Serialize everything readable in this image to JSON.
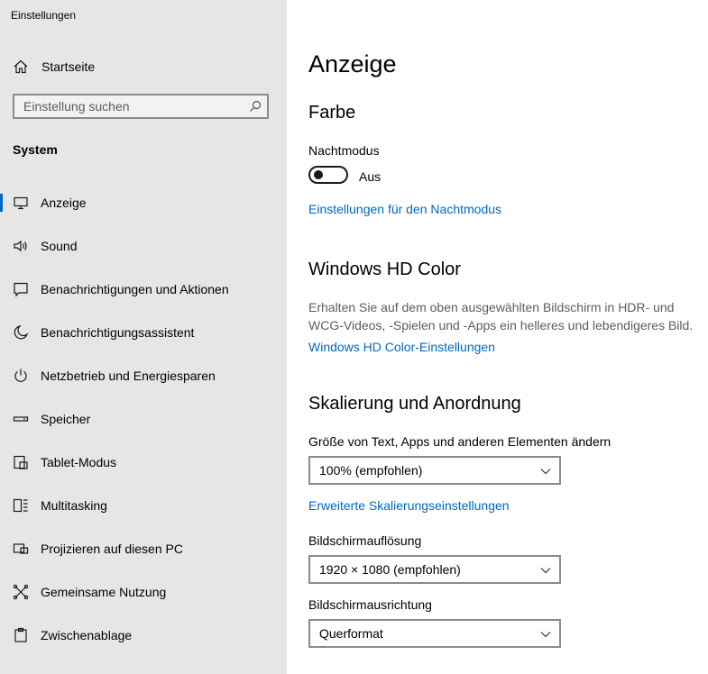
{
  "window": {
    "title": "Einstellungen"
  },
  "sidebar": {
    "home_label": "Startseite",
    "search_placeholder": "Einstellung suchen",
    "section": "System",
    "items": [
      {
        "label": "Anzeige",
        "icon": "monitor-icon",
        "active": true
      },
      {
        "label": "Sound",
        "icon": "speaker-icon"
      },
      {
        "label": "Benachrichtigungen und Aktionen",
        "icon": "notification-icon"
      },
      {
        "label": "Benachrichtigungsassistent",
        "icon": "moon-icon"
      },
      {
        "label": "Netzbetrieb und Energiesparen",
        "icon": "power-icon"
      },
      {
        "label": "Speicher",
        "icon": "storage-icon"
      },
      {
        "label": "Tablet-Modus",
        "icon": "tablet-icon"
      },
      {
        "label": "Multitasking",
        "icon": "multitasking-icon"
      },
      {
        "label": "Projizieren auf diesen PC",
        "icon": "project-icon"
      },
      {
        "label": "Gemeinsame Nutzung",
        "icon": "share-icon"
      },
      {
        "label": "Zwischenablage",
        "icon": "clipboard-icon"
      }
    ]
  },
  "main": {
    "title": "Anzeige",
    "color": {
      "heading": "Farbe",
      "night_label": "Nachtmodus",
      "night_state": "Aus",
      "night_link": "Einstellungen für den Nachtmodus"
    },
    "hdr": {
      "heading": "Windows HD Color",
      "description": "Erhalten Sie auf dem oben ausgewählten Bildschirm in HDR- und WCG-Videos, -Spielen und -Apps ein helleres und lebendigeres Bild.",
      "link": "Windows HD Color-Einstellungen"
    },
    "scale": {
      "heading": "Skalierung und Anordnung",
      "size_label": "Größe von Text, Apps und anderen Elementen ändern",
      "size_value": "100% (empfohlen)",
      "advanced_link": "Erweiterte Skalierungseinstellungen",
      "resolution_label": "Bildschirmauflösung",
      "resolution_value": "1920 × 1080 (empfohlen)",
      "orientation_label": "Bildschirmausrichtung",
      "orientation_value": "Querformat"
    }
  },
  "colors": {
    "accent": "#0067c0",
    "sidebar_bg": "#e6e6e6"
  }
}
